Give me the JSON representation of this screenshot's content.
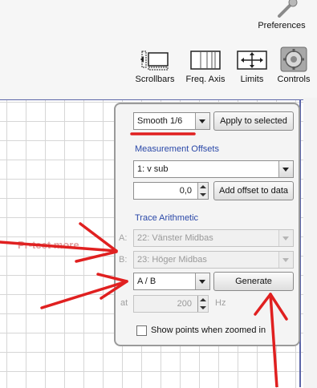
{
  "toolbar": {
    "preferences_label": "Preferences",
    "scrollbars_label": "Scrollbars",
    "freq_axis_label": "Freq. Axis",
    "limits_label": "Limits",
    "controls_label": "Controls"
  },
  "panel": {
    "smoothing_value": "Smooth 1/6",
    "apply_label": "Apply to selected",
    "offsets_title": "Measurement Offsets",
    "measurement_value": "1: v sub",
    "offset_value": "0,0",
    "add_offset_label": "Add offset to data",
    "arith_title": "Trace Arithmetic",
    "a_label": "A:",
    "a_value": "22: Vänster Midbas",
    "b_label": "B:",
    "b_value": "23: Höger Midbas",
    "operation_value": "A / B",
    "generate_label": "Generate",
    "at_label": "at",
    "freq_value": "200",
    "hz_label": "Hz",
    "show_points_label": "Show points when zoomed in",
    "show_points_checked": false
  },
  "background_text": "Pr-tect more",
  "colors": {
    "annotation_red": "#e02020",
    "section_blue": "#2a48a8",
    "graph_border": "#5a64a8"
  }
}
